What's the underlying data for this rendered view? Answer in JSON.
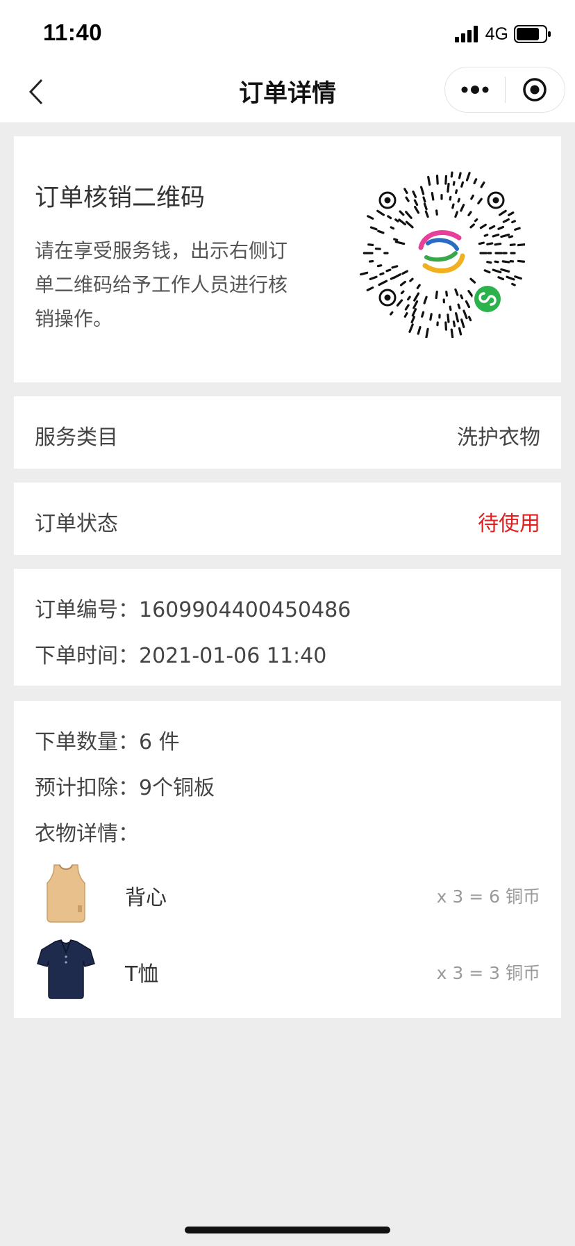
{
  "status_bar": {
    "time": "11:40",
    "network": "4G"
  },
  "nav": {
    "title": "订单详情"
  },
  "qr_section": {
    "title": "订单核销二维码",
    "description": "请在享受服务钱，出示右侧订单二维码给予工作人员进行核销操作。"
  },
  "service": {
    "label": "服务类目",
    "value": "洗护衣物"
  },
  "status": {
    "label": "订单状态",
    "value": "待使用",
    "color": "#e02020"
  },
  "order": {
    "number_label": "订单编号：",
    "number": "1609904400450486",
    "time_label": "下单时间：",
    "time": "2021-01-06 11:40"
  },
  "details": {
    "quantity_label": "下单数量：",
    "quantity": "6 件",
    "deduct_label": "预计扣除：",
    "deduct": "9个铜板",
    "clothes_label": "衣物详情：",
    "items": [
      {
        "name": "背心",
        "qty": "x 3 = 6 铜币",
        "icon": "vest-icon"
      },
      {
        "name": "T恤",
        "qty": "x 3 = 3 铜币",
        "icon": "tshirt-icon"
      }
    ]
  }
}
